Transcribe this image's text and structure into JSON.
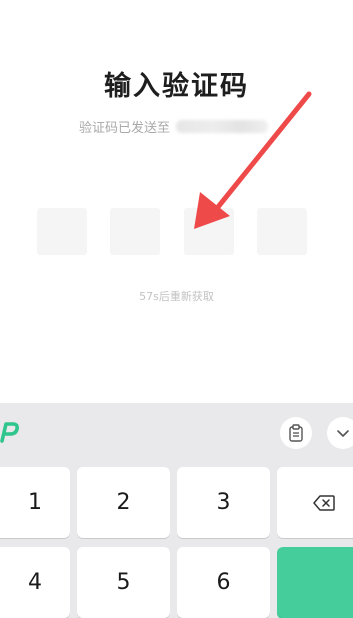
{
  "verification": {
    "title": "输入验证码",
    "subtitle": "验证码已发送至",
    "resend_hint": "57s后重新获取"
  },
  "keyboard": {
    "logo_icon": "ime-logo-icon",
    "keys": {
      "k1": "1",
      "k2": "2",
      "k3": "3",
      "k4": "4",
      "k5": "5",
      "k6": "6"
    },
    "accent_color": "#46cd9c"
  },
  "annotation": {
    "arrow_color": "#ef4a4a"
  }
}
